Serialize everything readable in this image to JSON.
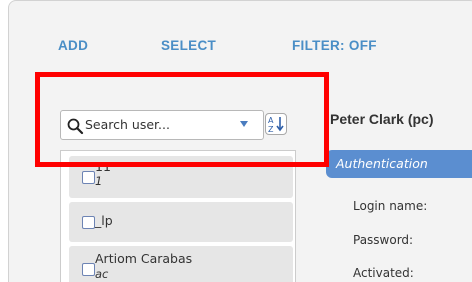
{
  "toolbar": {
    "add": "ADD",
    "select": "SELECT",
    "filter": "FILTER: OFF"
  },
  "search": {
    "placeholder": "Search user..."
  },
  "users": [
    {
      "name": "11",
      "login": "1"
    },
    {
      "name": "_lp",
      "login": ""
    },
    {
      "name": "Artiom Carabas",
      "login": "ac"
    }
  ],
  "detail": {
    "title": "Peter Clark (pc)",
    "tab": "Authentication",
    "fields": [
      "Login name:",
      "Password:",
      "Activated:"
    ]
  },
  "colors": {
    "accent": "#4a8ec6",
    "tab": "#5b8ed0",
    "highlight": "#ff0000"
  }
}
